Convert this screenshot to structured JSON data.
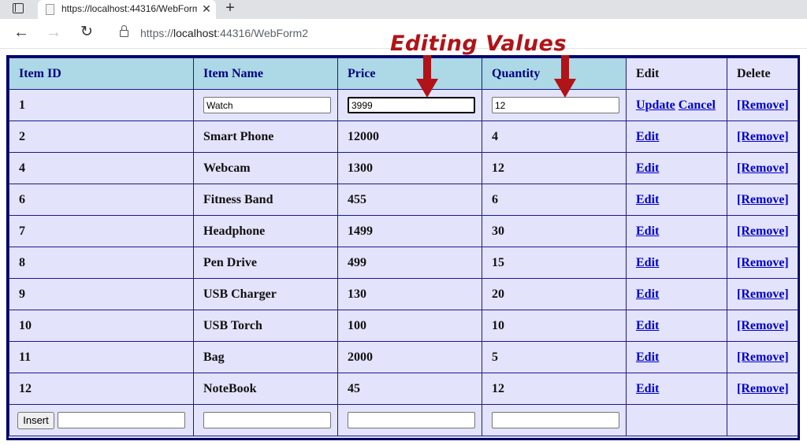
{
  "browser": {
    "tab_title": "https://localhost:44316/WebForm",
    "url_prefix": "https://",
    "url_host": "localhost",
    "url_rest": ":44316/WebForm2"
  },
  "annotation": {
    "text": "Editing Values",
    "color": "#b01318"
  },
  "grid": {
    "headers": [
      "Item ID",
      "Item Name",
      "Price",
      "Quantity",
      "Edit",
      "Delete"
    ],
    "edit_row": {
      "id": "1",
      "name": "Watch",
      "price": "3999",
      "quantity": "12",
      "update_label": "Update",
      "cancel_label": "Cancel",
      "remove_label": "[Remove]"
    },
    "rows": [
      {
        "id": "2",
        "name": "Smart Phone",
        "price": "12000",
        "quantity": "4"
      },
      {
        "id": "4",
        "name": "Webcam",
        "price": "1300",
        "quantity": "12"
      },
      {
        "id": "6",
        "name": "Fitness Band",
        "price": "455",
        "quantity": "6"
      },
      {
        "id": "7",
        "name": "Headphone",
        "price": "1499",
        "quantity": "30"
      },
      {
        "id": "8",
        "name": "Pen Drive",
        "price": "499",
        "quantity": "15"
      },
      {
        "id": "9",
        "name": "USB Charger",
        "price": "130",
        "quantity": "20"
      },
      {
        "id": "10",
        "name": "USB Torch",
        "price": "100",
        "quantity": "10"
      },
      {
        "id": "11",
        "name": "Bag",
        "price": "2000",
        "quantity": "5"
      },
      {
        "id": "12",
        "name": "NoteBook",
        "price": "45",
        "quantity": "12"
      }
    ],
    "edit_label": "Edit",
    "remove_label": "[Remove]",
    "insert_label": "Insert",
    "header_color": "#add8e6",
    "row_color": "#e3e3fb",
    "border_color": "#000066"
  }
}
